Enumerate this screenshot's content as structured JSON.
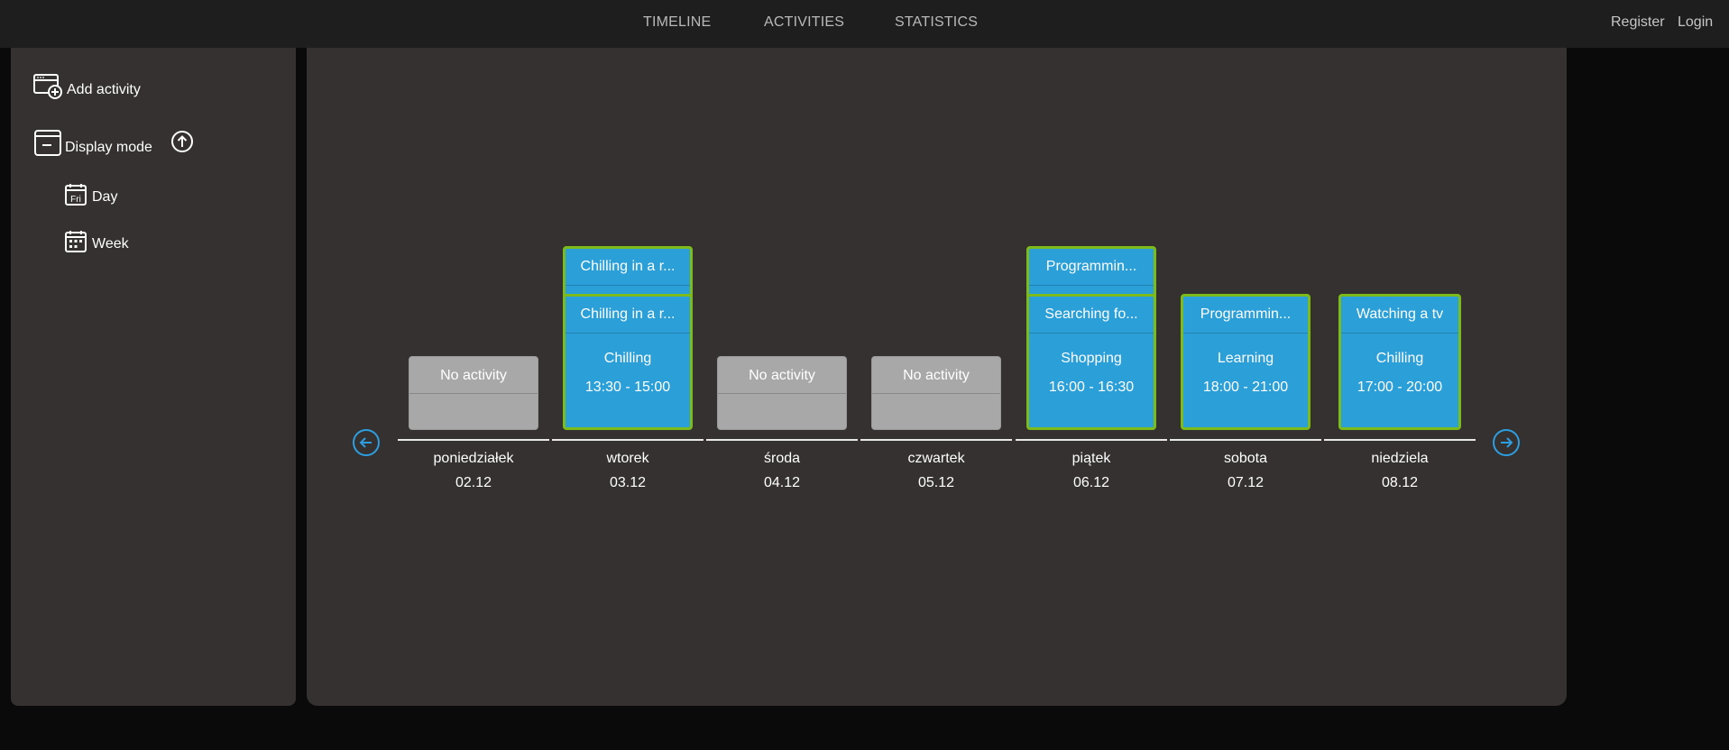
{
  "nav": {
    "timeline": "TIMELINE",
    "activities": "ACTIVITIES",
    "statistics": "STATISTICS",
    "register": "Register",
    "login": "Login"
  },
  "sidebar": {
    "add_activity": "Add activity",
    "display_mode": "Display mode",
    "day": "Day",
    "day_icon_text": "Fri",
    "week": "Week"
  },
  "week": {
    "days": [
      {
        "name": "poniedziałek",
        "date": "02.12",
        "empty_label": "No activity"
      },
      {
        "name": "wtorek",
        "date": "03.12",
        "top_title": "Chilling in a r...",
        "title": "Chilling in a r...",
        "category": "Chilling",
        "time": "13:30 - 15:00"
      },
      {
        "name": "środa",
        "date": "04.12",
        "empty_label": "No activity"
      },
      {
        "name": "czwartek",
        "date": "05.12",
        "empty_label": "No activity"
      },
      {
        "name": "piątek",
        "date": "06.12",
        "top_title": "Programmin...",
        "title": "Searching fo...",
        "category": "Shopping",
        "time": "16:00 - 16:30"
      },
      {
        "name": "sobota",
        "date": "07.12",
        "title": "Programmin...",
        "category": "Learning",
        "time": "18:00 - 21:00"
      },
      {
        "name": "niedziela",
        "date": "08.12",
        "title": "Watching a tv",
        "category": "Chilling",
        "time": "17:00 - 20:00"
      }
    ]
  },
  "colors": {
    "accent": "#2d9ee0",
    "card_active": "#2b9fd8",
    "card_border": "#7cbb1a",
    "card_empty": "#a8a8a8",
    "panel": "#343130",
    "topbar": "#1e1e1e"
  },
  "icons": {
    "add_activity": "calendar-add-icon",
    "display_mode": "calendar-minus-icon",
    "collapse": "arrow-up-circle-icon",
    "day": "calendar-day-icon",
    "week": "calendar-week-icon",
    "prev": "arrow-left-circle-icon",
    "next": "arrow-right-circle-icon"
  }
}
